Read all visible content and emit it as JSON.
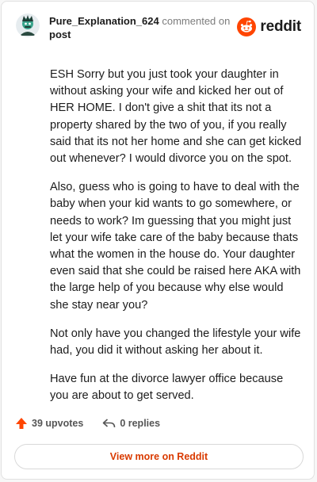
{
  "header": {
    "username": "Pure_Explanation_624",
    "action_text": "commented on",
    "target": "post",
    "brand": "reddit"
  },
  "comment": {
    "paragraphs": [
      "ESH Sorry but you just took your daughter in without asking your wife and kicked her out of HER HOME. I don't give a shit that its not a property shared by the two of you, if you really said that its not her home and she can get kicked out whenever? I would divorce you on the spot.",
      "Also, guess who is going to have to deal with the baby when your kid wants to go somewhere, or needs to work? Im guessing that you might just let your wife take care of the baby because thats what the women in the house do. Your daughter even said that she could be raised here AKA with the large help of you because why else would she stay near you?",
      "Not only have you changed the lifestyle your wife had, you did it without asking her about it.",
      "Have fun at the divorce lawyer office because you are about to get served."
    ]
  },
  "actions": {
    "upvotes": "39 upvotes",
    "replies": "0 replies"
  },
  "footer": {
    "view_more": "View more on Reddit"
  },
  "colors": {
    "brand": "#ff4500",
    "link": "#d93a00"
  }
}
